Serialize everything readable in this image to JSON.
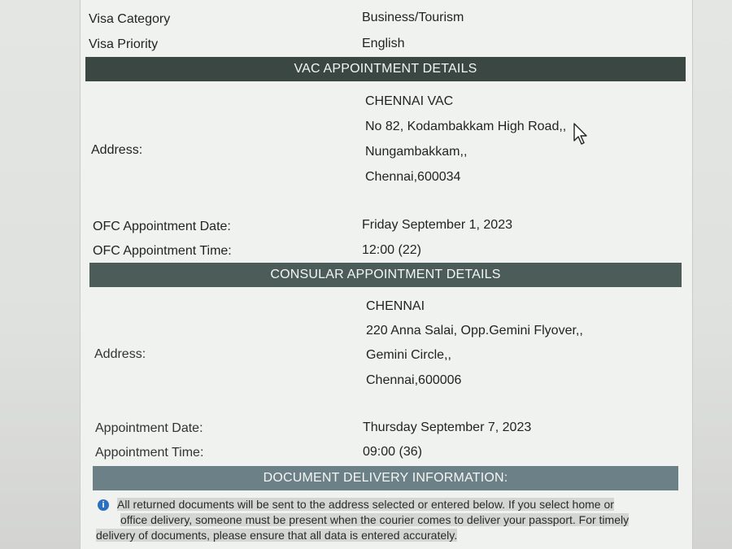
{
  "rows_top": {
    "visa_category": {
      "label": "Visa Category",
      "value": "Business/Tourism"
    },
    "visa_priority": {
      "label": "Visa Priority",
      "value": "English"
    }
  },
  "vac": {
    "header": "VAC APPOINTMENT DETAILS",
    "address_label": "Address:",
    "address_lines": [
      "CHENNAI VAC",
      "No 82, Kodambakkam High Road,,",
      "Nungambakkam,,",
      "Chennai,600034"
    ],
    "date_label": "OFC Appointment Date:",
    "date_value": "Friday September 1, 2023",
    "time_label": "OFC Appointment Time:",
    "time_value": "12:00 (22)"
  },
  "consular": {
    "header": "CONSULAR APPOINTMENT DETAILS",
    "address_label": "Address:",
    "address_lines": [
      "CHENNAI",
      "220 Anna Salai, Opp.Gemini Flyover,,",
      "Gemini Circle,,",
      "Chennai,600006"
    ],
    "date_label": "Appointment Date:",
    "date_value": "Thursday September 7, 2023",
    "time_label": "Appointment Time:",
    "time_value": "09:00 (36)"
  },
  "delivery": {
    "header": "DOCUMENT DELIVERY INFORMATION:",
    "info_line1": "All returned documents will be sent to the address selected or entered below. If you select home or",
    "info_line2": "office delivery, someone must be present when the courier comes to deliver your passport. For timely",
    "info_line3": "delivery of documents, please ensure that all data is entered accurately.",
    "icon": "info-icon"
  },
  "colors": {
    "header_dark": "#3a4743",
    "header_mid": "#4b5c59",
    "header_light": "#6c8087",
    "info_icon": "#2d6fbf"
  }
}
